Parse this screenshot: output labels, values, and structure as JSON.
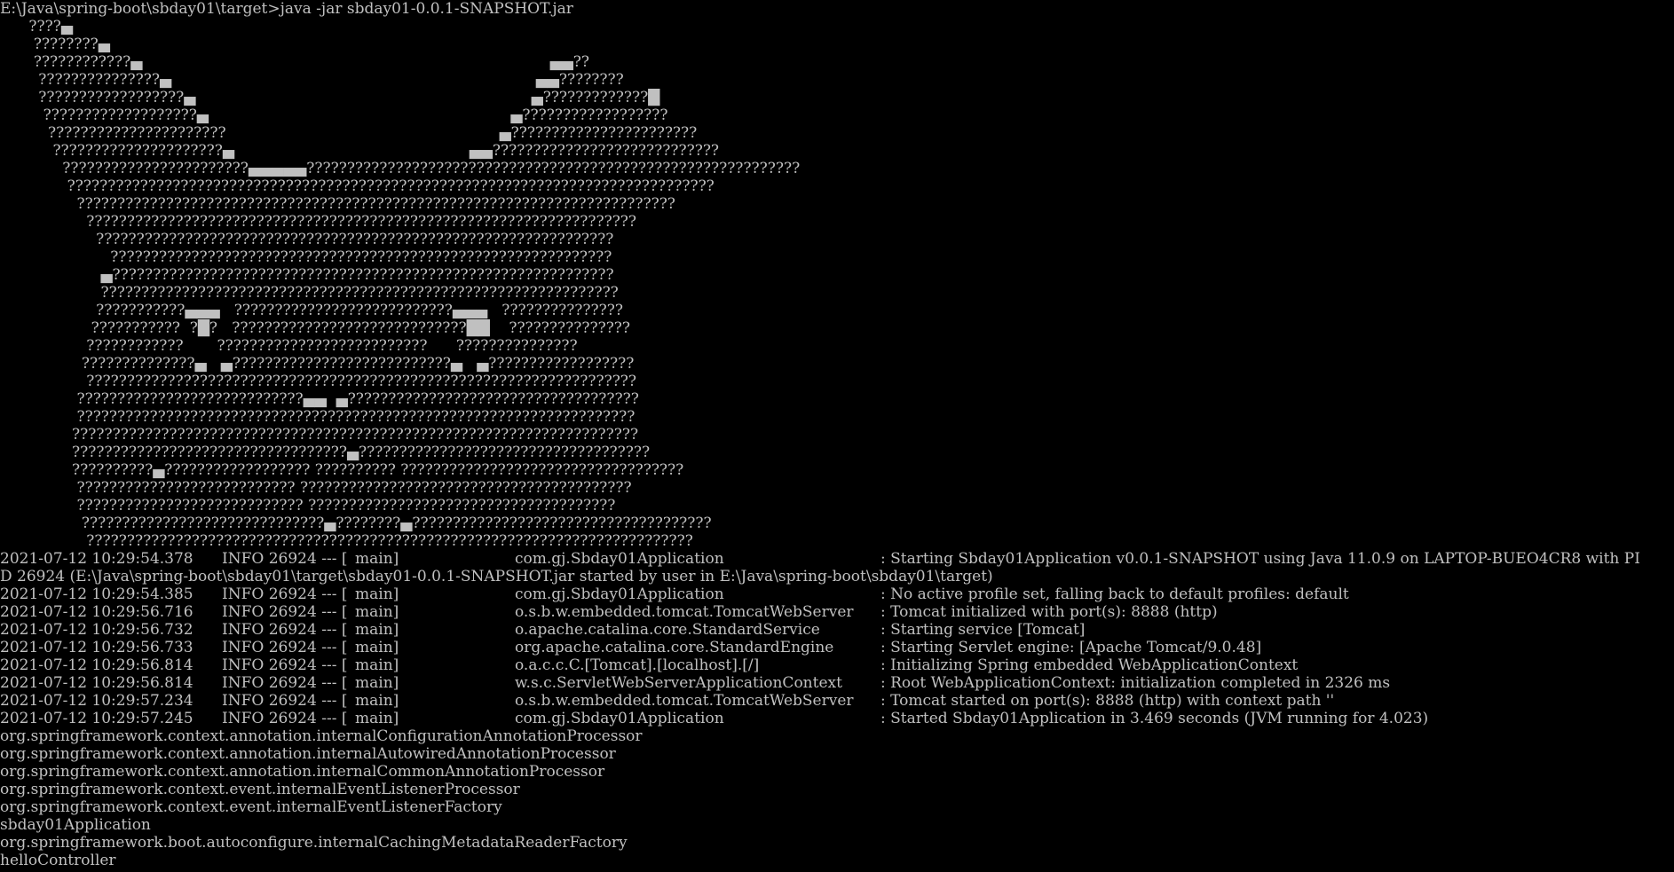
{
  "window": {
    "background_color": "#000000",
    "text_color": "#c0c0c0"
  },
  "command": "E:\\Java\\spring-boot\\sbday01\\target>java -jar sbday01-0.0.1-SNAPSHOT.jar",
  "banner": [
    "      ????▄",
    "       ????????▄",
    "       ????????????▄                                                                                     ▄▄??",
    "        ???????????????▄                                                                            ▄▄????????",
    "        ??????????????????▄                                                                      ▄?????????????█",
    "         ???????????????????▄                                                               ▄??????????????????",
    "          ??????????????????????                                                         ▄???????????????????????",
    "           ?????????????????????▄                                                 ▄▄????????????????????????????",
    "             ???????????????????????▄▄▄▄▄?????????????????????????????????????????????????????????????",
    "              ????????????????????????????????????????????????????????????????????????????????",
    "                ??????????????????????????????????????????????????????????????????????????",
    "                  ????????????????????????????????????????????????????????????????????",
    "                    ????????????????????????????????????????????????????????????????",
    "                       ??????????????????????????????????????????????????????????????",
    "                     ▄??????????????????????????????????????????????????????????????",
    "                     ????????????????????????????????????????????????????????????????",
    "                    ???????????▄▄▄   ???????????????????????????▄▄▄   ???????????????",
    "                   ???????????  ?█?   ?????????????????????????????██    ???????????????",
    "                  ????????????       ??????????????????????????      ???????????????",
    "                 ??????????????▄   ▄???????????????????????????▄   ▄??????????????????",
    "                  ????????????????????????????????????????????????????????????????????",
    "                ????????????????????????????▄▄  ▄????????????????????????????????????",
    "                ?????????????????????????????????????????????????????????????????????",
    "               ??????????????????????????????????????????????????????????????????????",
    "               ??????????????????????????????????▄????????????????????????????????????",
    "               ??????????▄?????????????????? ?????????? ???????????????????????????????????",
    "                ??????????????????????????? ?????????????????????????????????????????",
    "                ???????????????????????????? ??????????????????????????????????????",
    "                 ??????????????????????????????▄????????▄?????????????????????????????????????",
    "                  ???????????????????????????????????????????????????????????????????????????"
  ],
  "log_entries": [
    {
      "timestamp": "2021-07-12 10:29:54.378",
      "level_pid": "INFO 26924 --- [",
      "thread": "main]",
      "logger": "com.gj.Sbday01Application",
      "message": ": Starting Sbday01Application v0.0.1-SNAPSHOT using Java 11.0.9 on LAPTOP-BUEO4CR8 with PI"
    },
    {
      "continuation": "D 26924 (E:\\Java\\spring-boot\\sbday01\\target\\sbday01-0.0.1-SNAPSHOT.jar started by user in E:\\Java\\spring-boot\\sbday01\\target)"
    },
    {
      "timestamp": "2021-07-12 10:29:54.385",
      "level_pid": "INFO 26924 --- [",
      "thread": "main]",
      "logger": "com.gj.Sbday01Application",
      "message": ": No active profile set, falling back to default profiles: default"
    },
    {
      "timestamp": "2021-07-12 10:29:56.716",
      "level_pid": "INFO 26924 --- [",
      "thread": "main]",
      "logger": "o.s.b.w.embedded.tomcat.TomcatWebServer",
      "message": ": Tomcat initialized with port(s): 8888 (http)"
    },
    {
      "timestamp": "2021-07-12 10:29:56.732",
      "level_pid": "INFO 26924 --- [",
      "thread": "main]",
      "logger": "o.apache.catalina.core.StandardService",
      "message": ": Starting service [Tomcat]"
    },
    {
      "timestamp": "2021-07-12 10:29:56.733",
      "level_pid": "INFO 26924 --- [",
      "thread": "main]",
      "logger": "org.apache.catalina.core.StandardEngine",
      "message": ": Starting Servlet engine: [Apache Tomcat/9.0.48]"
    },
    {
      "timestamp": "2021-07-12 10:29:56.814",
      "level_pid": "INFO 26924 --- [",
      "thread": "main]",
      "logger": "o.a.c.c.C.[Tomcat].[localhost].[/]",
      "message": ": Initializing Spring embedded WebApplicationContext"
    },
    {
      "timestamp": "2021-07-12 10:29:56.814",
      "level_pid": "INFO 26924 --- [",
      "thread": "main]",
      "logger": "w.s.c.ServletWebServerApplicationContext",
      "message": ": Root WebApplicationContext: initialization completed in 2326 ms"
    },
    {
      "timestamp": "2021-07-12 10:29:57.234",
      "level_pid": "INFO 26924 --- [",
      "thread": "main]",
      "logger": "o.s.b.w.embedded.tomcat.TomcatWebServer",
      "message": ": Tomcat started on port(s): 8888 (http) with context path ''"
    },
    {
      "timestamp": "2021-07-12 10:29:57.245",
      "level_pid": "INFO 26924 --- [",
      "thread": "main]",
      "logger": "com.gj.Sbday01Application",
      "message": ": Started Sbday01Application in 3.469 seconds (JVM running for 4.023)"
    }
  ],
  "bean_names": [
    "org.springframework.context.annotation.internalConfigurationAnnotationProcessor",
    "org.springframework.context.annotation.internalAutowiredAnnotationProcessor",
    "org.springframework.context.annotation.internalCommonAnnotationProcessor",
    "org.springframework.context.event.internalEventListenerProcessor",
    "org.springframework.context.event.internalEventListenerFactory",
    "sbday01Application",
    "org.springframework.boot.autoconfigure.internalCachingMetadataReaderFactory",
    "helloController"
  ]
}
